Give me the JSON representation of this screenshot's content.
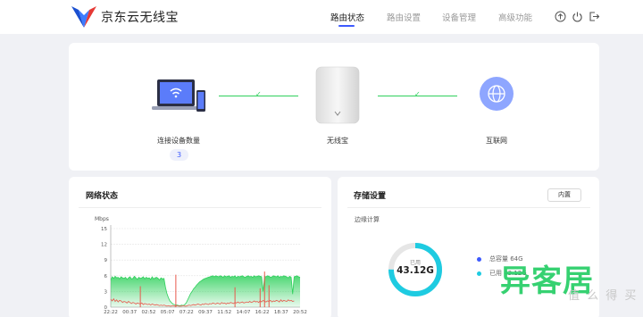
{
  "header": {
    "brand": "京东云无线宝",
    "nav": [
      "路由状态",
      "路由设置",
      "设备管理",
      "高级功能"
    ],
    "active_nav": "路由状态",
    "icons": [
      "upload-icon",
      "power-icon",
      "logout-icon"
    ],
    "accent_color": "#3d5afe"
  },
  "topology": {
    "devices_label": "连接设备数量",
    "device_count": "3",
    "router_label": "无线宝",
    "internet_label": "互联网",
    "link_status_color": "#2fd05c"
  },
  "network": {
    "title": "网络状态",
    "unit": "Mbps"
  },
  "storage": {
    "title": "存储设置",
    "button_label": "内置",
    "subtitle": "边缘计算",
    "used_label": "已用",
    "used_value": "43.12G",
    "used_fraction": 0.75,
    "legend": [
      "总容量 64G",
      "已用 43.12G"
    ],
    "legend_colors": [
      "#3d5afe",
      "#1ecbe1"
    ]
  },
  "watermark": {
    "text": "异客居",
    "sub": "值 么 得 买"
  },
  "chart_data": {
    "type": "area",
    "xlabel": "",
    "ylabel": "Mbps",
    "ylim": [
      0,
      15
    ],
    "y_ticks": [
      "15",
      "12",
      "9",
      "6",
      "3",
      "0"
    ],
    "x_ticks": [
      "22:22",
      "00:37",
      "02:52",
      "05:07",
      "07:22",
      "09:37",
      "11:52",
      "14:07",
      "16:22",
      "18:37",
      "20:52"
    ],
    "grid": true,
    "series": [
      {
        "color": "#2fd05c",
        "values": [
          5.2,
          5.8,
          5.5,
          5.9,
          5.6,
          5.7,
          5.4,
          5.8,
          5.6,
          5.5,
          5.7,
          5.3,
          5.6,
          5.8,
          5.4,
          5.5,
          5.9,
          5.6,
          5.3,
          5.7,
          5.5,
          5.6,
          5.8,
          5.4,
          5.7,
          5.5,
          5.6,
          5.3,
          5.8,
          5.4,
          5.6,
          5.7,
          5.5,
          5.2,
          5.6,
          5.4,
          5.5,
          3.8,
          2.6,
          1.8,
          1.2,
          0.9,
          0.6,
          0.5,
          0.4,
          0.4,
          0.3,
          0.3,
          0.4,
          0.3,
          0.5,
          0.8,
          1.4,
          2.0,
          2.6,
          3.0,
          3.5,
          3.8,
          4.2,
          4.5,
          4.8,
          5.0,
          5.2,
          5.4,
          5.5,
          5.6,
          5.7,
          5.8,
          5.9,
          6.0,
          5.8,
          6.0,
          5.9,
          5.8,
          6.0,
          5.9,
          5.7,
          6.0,
          5.8,
          5.9,
          6.0,
          5.7,
          5.9,
          5.8,
          6.0,
          5.6,
          5.9,
          5.8,
          5.9,
          6.0,
          5.8,
          5.7,
          5.9,
          6.0,
          5.8,
          5.9,
          5.7,
          6.0,
          5.8,
          5.9,
          6.0,
          5.9,
          5.8,
          3.0,
          5.9,
          5.8,
          6.0,
          5.9,
          5.7,
          5.8,
          6.0,
          5.9,
          5.8,
          6.0,
          5.7,
          5.9,
          5.8,
          6.0,
          5.9,
          5.8,
          5.6,
          5.9,
          5.7,
          2.5,
          5.8,
          5.9,
          6.0,
          5.8,
          5.7
        ]
      },
      {
        "color": "#e8584c",
        "values": [
          1.5,
          1.2,
          1.6,
          1.1,
          1.4,
          1.0,
          1.3,
          1.2,
          0.9,
          1.1,
          1.0,
          0.8,
          1.1,
          0.9,
          0.7,
          0.9,
          0.8,
          0.6,
          0.8,
          0.7,
          0.6,
          0.8,
          0.5,
          0.7,
          0.6,
          0.5,
          0.6,
          0.4,
          0.6,
          0.5,
          0.4,
          0.5,
          0.4,
          0.3,
          0.4,
          0.3,
          0.4,
          0.3,
          0.2,
          0.3,
          0.2,
          0.2,
          0.3,
          0.2,
          0.2,
          0.3,
          0.2,
          0.2,
          0.2,
          0.3,
          0.2,
          0.2,
          0.3,
          0.4,
          0.3,
          0.4,
          0.5,
          0.4,
          0.5,
          0.6,
          0.5,
          0.4,
          0.6,
          0.5,
          0.7,
          0.6,
          0.5,
          0.7,
          0.6,
          0.8,
          0.7,
          0.6,
          0.8,
          0.7,
          0.6,
          0.9,
          0.7,
          0.8,
          0.6,
          0.8,
          0.7,
          0.9,
          0.8,
          0.7,
          0.9,
          0.8,
          1.0,
          0.8,
          0.9,
          1.0,
          0.8,
          0.9,
          1.0,
          0.9,
          1.1,
          0.9,
          1.0,
          1.2,
          1.0,
          1.1,
          0.9,
          1.2,
          1.0,
          1.3,
          1.1,
          1.0,
          1.2,
          1.1,
          1.3,
          1.0,
          1.2,
          1.1,
          1.3,
          1.2,
          1.0,
          1.4,
          1.1,
          1.3,
          1.2,
          1.1,
          1.4,
          1.2,
          1.3,
          1.1,
          1.2
        ]
      }
    ],
    "spikes": [
      {
        "index": 20,
        "value": 4.0
      },
      {
        "index": 44,
        "value": 6.2
      },
      {
        "index": 84,
        "value": 3.8
      },
      {
        "index": 101,
        "value": 3.6
      },
      {
        "index": 104,
        "value": 6.8
      },
      {
        "index": 107,
        "value": 4.2
      }
    ]
  }
}
